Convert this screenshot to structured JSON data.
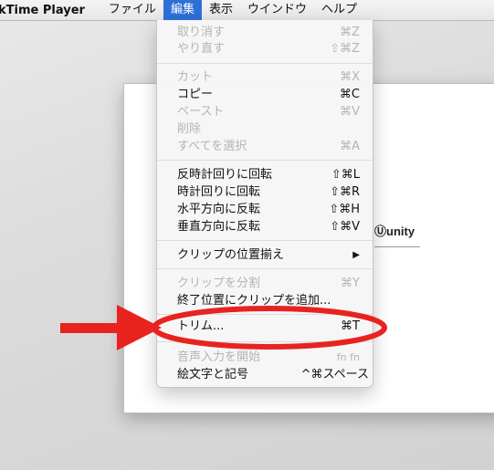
{
  "menubar": {
    "app_name": "kTime Player",
    "items": [
      "ファイル",
      "編集",
      "表示",
      "ウインドウ",
      "ヘルプ"
    ]
  },
  "background_window": {
    "logo_text": "unity"
  },
  "edit_menu": {
    "items": [
      {
        "label": "取り消す",
        "shortcut": "⌘Z",
        "enabled": false
      },
      {
        "label": "やり直す",
        "shortcut": "⇧⌘Z",
        "enabled": false
      },
      {
        "label": "カット",
        "shortcut": "⌘X",
        "enabled": false
      },
      {
        "label": "コピー",
        "shortcut": "⌘C",
        "enabled": true
      },
      {
        "label": "ペースト",
        "shortcut": "⌘V",
        "enabled": false
      },
      {
        "label": "削除",
        "shortcut": "",
        "enabled": false
      },
      {
        "label": "すべてを選択",
        "shortcut": "⌘A",
        "enabled": false
      },
      {
        "label": "反時計回りに回転",
        "shortcut": "⇧⌘L",
        "enabled": true
      },
      {
        "label": "時計回りに回転",
        "shortcut": "⇧⌘R",
        "enabled": true
      },
      {
        "label": "水平方向に反転",
        "shortcut": "⇧⌘H",
        "enabled": true
      },
      {
        "label": "垂直方向に反転",
        "shortcut": "⇧⌘V",
        "enabled": true
      },
      {
        "label": "クリップの位置揃え",
        "shortcut": "▶",
        "enabled": true
      },
      {
        "label": "クリップを分割",
        "shortcut": "⌘Y",
        "enabled": false
      },
      {
        "label": "終了位置にクリップを追加...",
        "shortcut": "",
        "enabled": true
      },
      {
        "label": "トリム...",
        "shortcut": "⌘T",
        "enabled": true
      },
      {
        "label": "音声入力を開始",
        "shortcut": "fn fn",
        "enabled": false
      },
      {
        "label": "絵文字と記号",
        "shortcut": "^⌘スペース",
        "enabled": true
      }
    ]
  },
  "annotation": {
    "color": "#e8231f",
    "highlighted_item": "トリム..."
  }
}
